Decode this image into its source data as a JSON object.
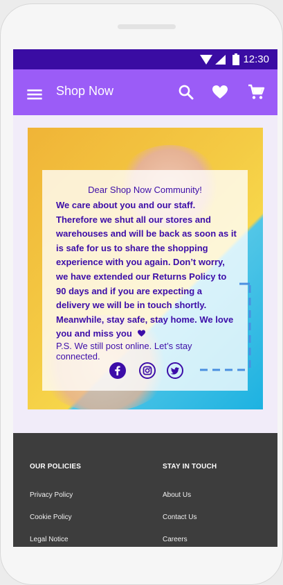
{
  "status_bar": {
    "time": "12:30"
  },
  "app_bar": {
    "title": "Shop Now"
  },
  "message": {
    "greeting": "Dear Shop Now Community!",
    "body": "We care about you and our staff. Therefore we shut all our stores and warehouses and will be back as soon as it is safe for us to share the shopping experience with you again. Don’t worry, we have extended our Returns Policy to 90 days and if you are expecting a delivery we will be in touch shortly. Meanwhile, stay safe, stay home. We love you and miss you",
    "ps": "P.S. We still post online. Let’s stay connected."
  },
  "footer": {
    "policies_heading": "OUR POLICIES",
    "policies": [
      "Privacy Policy",
      "Cookie Policy",
      "Legal Notice"
    ],
    "contact_heading": "STAY IN TOUCH",
    "contact": [
      "About Us",
      "Contact Us",
      "Careers"
    ]
  },
  "colors": {
    "status_bar": "#3a0ca3",
    "app_bar": "#9b5cf7",
    "text_purple": "#3c0da8",
    "footer": "#3d3d3d",
    "guide_lines": "#4a8fe0"
  },
  "icons": [
    "menu-icon",
    "search-icon",
    "heart-icon",
    "cart-icon",
    "wifi-icon",
    "signal-icon",
    "battery-icon",
    "facebook-icon",
    "instagram-icon",
    "twitter-icon"
  ]
}
